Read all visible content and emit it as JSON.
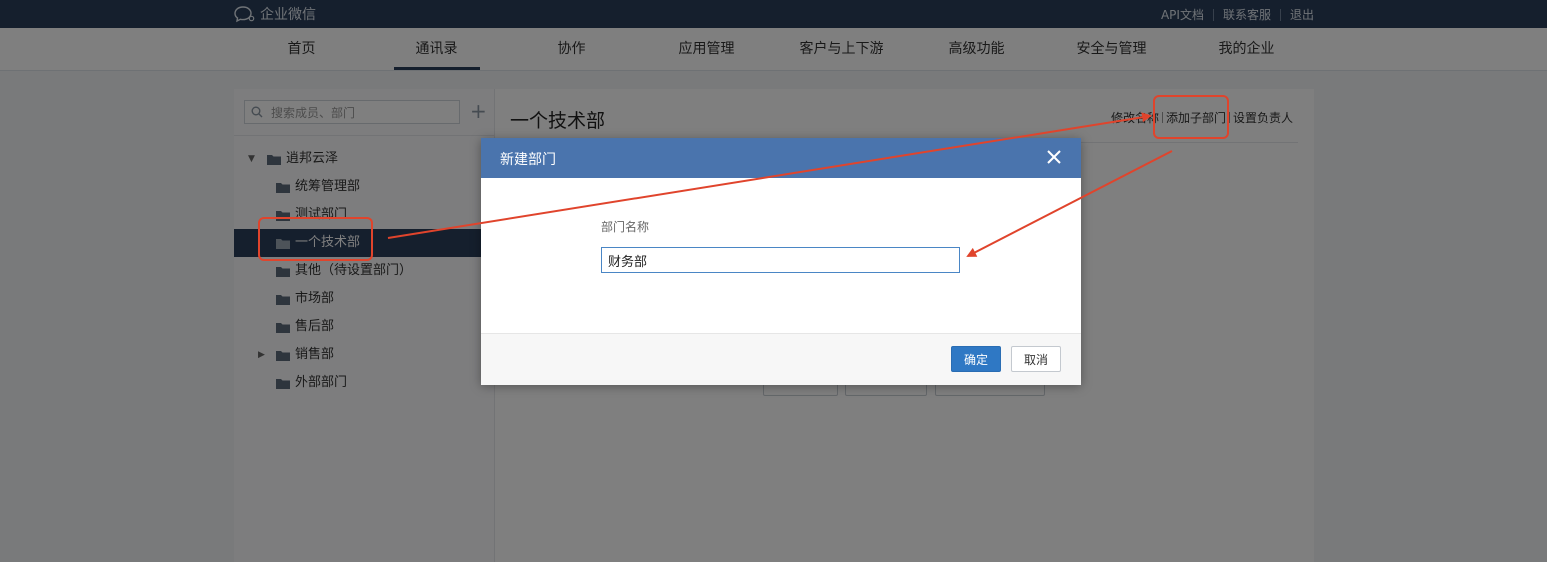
{
  "topbar": {
    "logo_text": "企业微信",
    "links": [
      "API文档",
      "联系客服",
      "退出"
    ]
  },
  "nav": {
    "items": [
      "首页",
      "通讯录",
      "协作",
      "应用管理",
      "客户与上下游",
      "高级功能",
      "安全与管理",
      "我的企业"
    ],
    "active_index": 1
  },
  "sidebar": {
    "search_placeholder": "搜索成员、部门",
    "add_icon": "plus-icon",
    "tree": [
      {
        "label": "逍邦云泽",
        "level": 0,
        "expanded": true
      },
      {
        "label": "统筹管理部",
        "level": 1
      },
      {
        "label": "测试部门",
        "level": 1
      },
      {
        "label": "一个技术部",
        "level": 1,
        "selected": true
      },
      {
        "label": "其他（待设置部门）",
        "level": 1
      },
      {
        "label": "市场部",
        "level": 1
      },
      {
        "label": "售后部",
        "level": 1
      },
      {
        "label": "销售部",
        "level": 1,
        "collapsed": true
      },
      {
        "label": "外部部门",
        "level": 1
      }
    ]
  },
  "main": {
    "title": "一个技术部",
    "actions": [
      "修改名称",
      "添加子部门",
      "设置负责人"
    ]
  },
  "dialog": {
    "title": "新建部门",
    "field_label": "部门名称",
    "field_value": "财务部",
    "ok_label": "确定",
    "cancel_label": "取消"
  },
  "colors": {
    "topbar": "#2b3e5a",
    "dialog_header": "#4a74ad",
    "primary_button": "#2f78c4",
    "annotation": "#e0442c"
  }
}
